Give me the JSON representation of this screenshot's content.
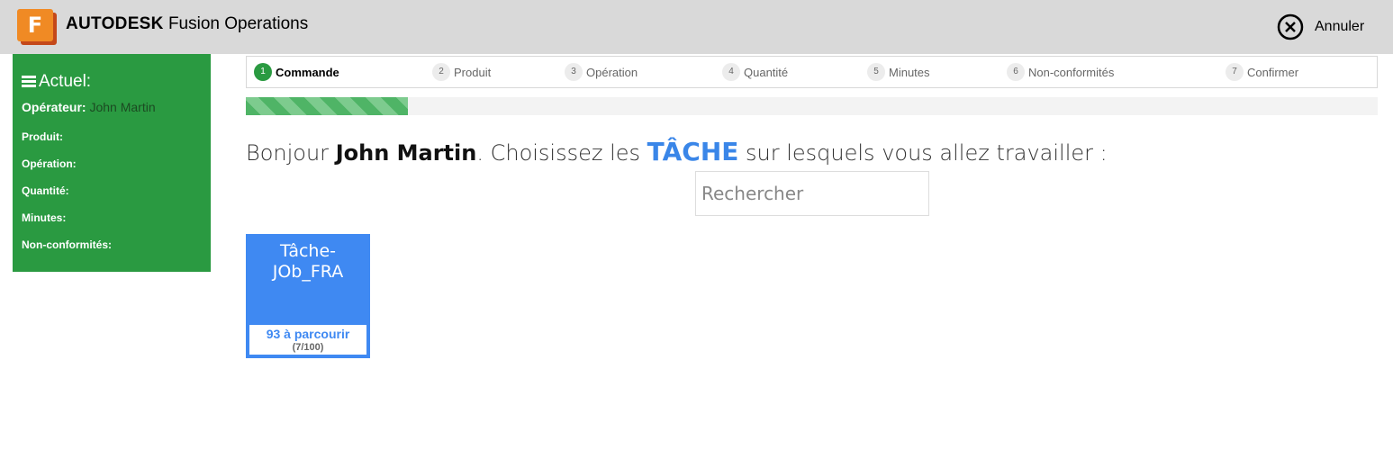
{
  "header": {
    "logo_letter": "F",
    "brand_bold": "AUTODESK",
    "brand_rest": "Fusion Operations",
    "cancel_label": "Annuler",
    "colors": {
      "bar": "#d9d9d9",
      "logo": "#f08a24"
    }
  },
  "sidebar": {
    "title": "Actuel:",
    "operator_label": "Opérateur:",
    "operator_value": "John Martin",
    "rows": [
      "Produit:",
      "Opération:",
      "Quantité:",
      "Minutes:",
      "Non-conformités:"
    ],
    "color": "#2a9a41"
  },
  "steps": [
    {
      "num": "1",
      "label": "Commande",
      "active": true
    },
    {
      "num": "2",
      "label": "Produit"
    },
    {
      "num": "3",
      "label": "Opération"
    },
    {
      "num": "4",
      "label": "Quantité"
    },
    {
      "num": "5",
      "label": "Minutes"
    },
    {
      "num": "6",
      "label": "Non-conformités"
    },
    {
      "num": "7",
      "label": "Confirmer"
    }
  ],
  "progress": {
    "fraction": 0.143
  },
  "greeting": {
    "hello": "Bonjour",
    "name": "John Martin",
    "mid": ". Choisissez les",
    "task": "TÂCHE",
    "end": "sur lesquels vous allez travailler :"
  },
  "search": {
    "placeholder": "Rechercher",
    "value": ""
  },
  "tasks": [
    {
      "title_line1": "Tâche-",
      "title_line2": "JOb_FRA",
      "remaining": "93 à parcourir",
      "count": "(7/100)",
      "color": "#3f89f2"
    }
  ]
}
